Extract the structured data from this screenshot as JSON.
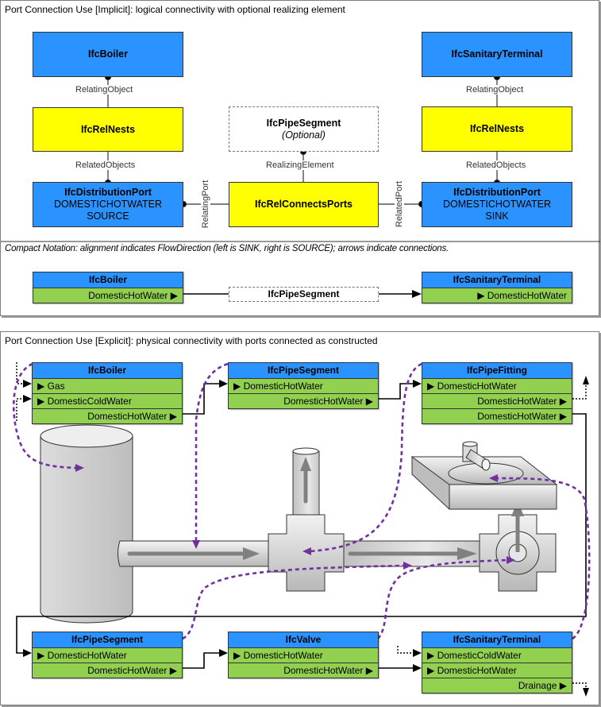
{
  "implicit": {
    "title": "Port Connection Use [Implicit]: logical connectivity with optional realizing element",
    "left": {
      "element": "IfcBoiler",
      "nests": "IfcRelNests",
      "port": {
        "name": "IfcDistributionPort",
        "system": "DOMESTICHOTWATER",
        "flow": "SOURCE"
      },
      "relating_object_label": "RelatingObject",
      "related_objects_label": "RelatedObjects"
    },
    "right": {
      "element": "IfcSanitaryTerminal",
      "nests": "IfcRelNests",
      "port": {
        "name": "IfcDistributionPort",
        "system": "DOMESTICHOTWATER",
        "flow": "SINK"
      },
      "relating_object_label": "RelatingObject",
      "related_objects_label": "RelatedObjects"
    },
    "center": {
      "realizing": {
        "name": "IfcPipeSegment",
        "note": "(Optional)"
      },
      "realizing_label": "RealizingElement",
      "relation": "IfcRelConnectsPorts",
      "relating_port_label": "RelatingPort",
      "related_port_label": "RelatedPort"
    }
  },
  "compact": {
    "title": "Compact Notation: alignment indicates FlowDirection (left is SINK, right is SOURCE); arrows indicate connections.",
    "source": {
      "name": "IfcBoiler",
      "port": "DomesticHotWater ▶"
    },
    "middle": "IfcPipeSegment",
    "sink": {
      "name": "IfcSanitaryTerminal",
      "port": "▶ DomesticHotWater"
    }
  },
  "explicit": {
    "title": "Port Connection Use [Explicit]: physical connectivity with ports connected as constructed",
    "components": [
      {
        "name": "IfcBoiler",
        "ports": [
          {
            "label": "▶ Gas",
            "dir": "in"
          },
          {
            "label": "▶ DomesticColdWater",
            "dir": "in"
          },
          {
            "label": "DomesticHotWater ▶",
            "dir": "out"
          }
        ]
      },
      {
        "name": "IfcPipeSegment",
        "ports": [
          {
            "label": "▶ DomesticHotWater",
            "dir": "in"
          },
          {
            "label": "DomesticHotWater ▶",
            "dir": "out"
          }
        ]
      },
      {
        "name": "IfcPipeFitting",
        "ports": [
          {
            "label": "▶ DomesticHotWater",
            "dir": "in"
          },
          {
            "label": "DomesticHotWater ▶",
            "dir": "out"
          },
          {
            "label": "DomesticHotWater ▶",
            "dir": "out"
          }
        ]
      },
      {
        "name": "IfcPipeSegment",
        "ports": [
          {
            "label": "▶ DomesticHotWater",
            "dir": "in"
          },
          {
            "label": "DomesticHotWater ▶",
            "dir": "out"
          }
        ]
      },
      {
        "name": "IfcValve",
        "ports": [
          {
            "label": "▶ DomesticHotWater",
            "dir": "in"
          },
          {
            "label": "DomesticHotWater ▶",
            "dir": "out"
          }
        ]
      },
      {
        "name": "IfcSanitaryTerminal",
        "ports": [
          {
            "label": "▶ DomesticColdWater",
            "dir": "in"
          },
          {
            "label": "▶ DomesticHotWater",
            "dir": "in"
          },
          {
            "label": "Drainage ▶",
            "dir": "out"
          }
        ]
      }
    ],
    "illustration": [
      "boiler-tank",
      "pipe-segment",
      "pipe-fitting-tee",
      "valve",
      "pipe-segment-riser",
      "sanitary-terminal-sink"
    ]
  },
  "colors": {
    "element": "#2b93ff",
    "relationship": "#ffff00",
    "port": "#92d050",
    "link": "#7030a0",
    "connection": "#000000"
  }
}
